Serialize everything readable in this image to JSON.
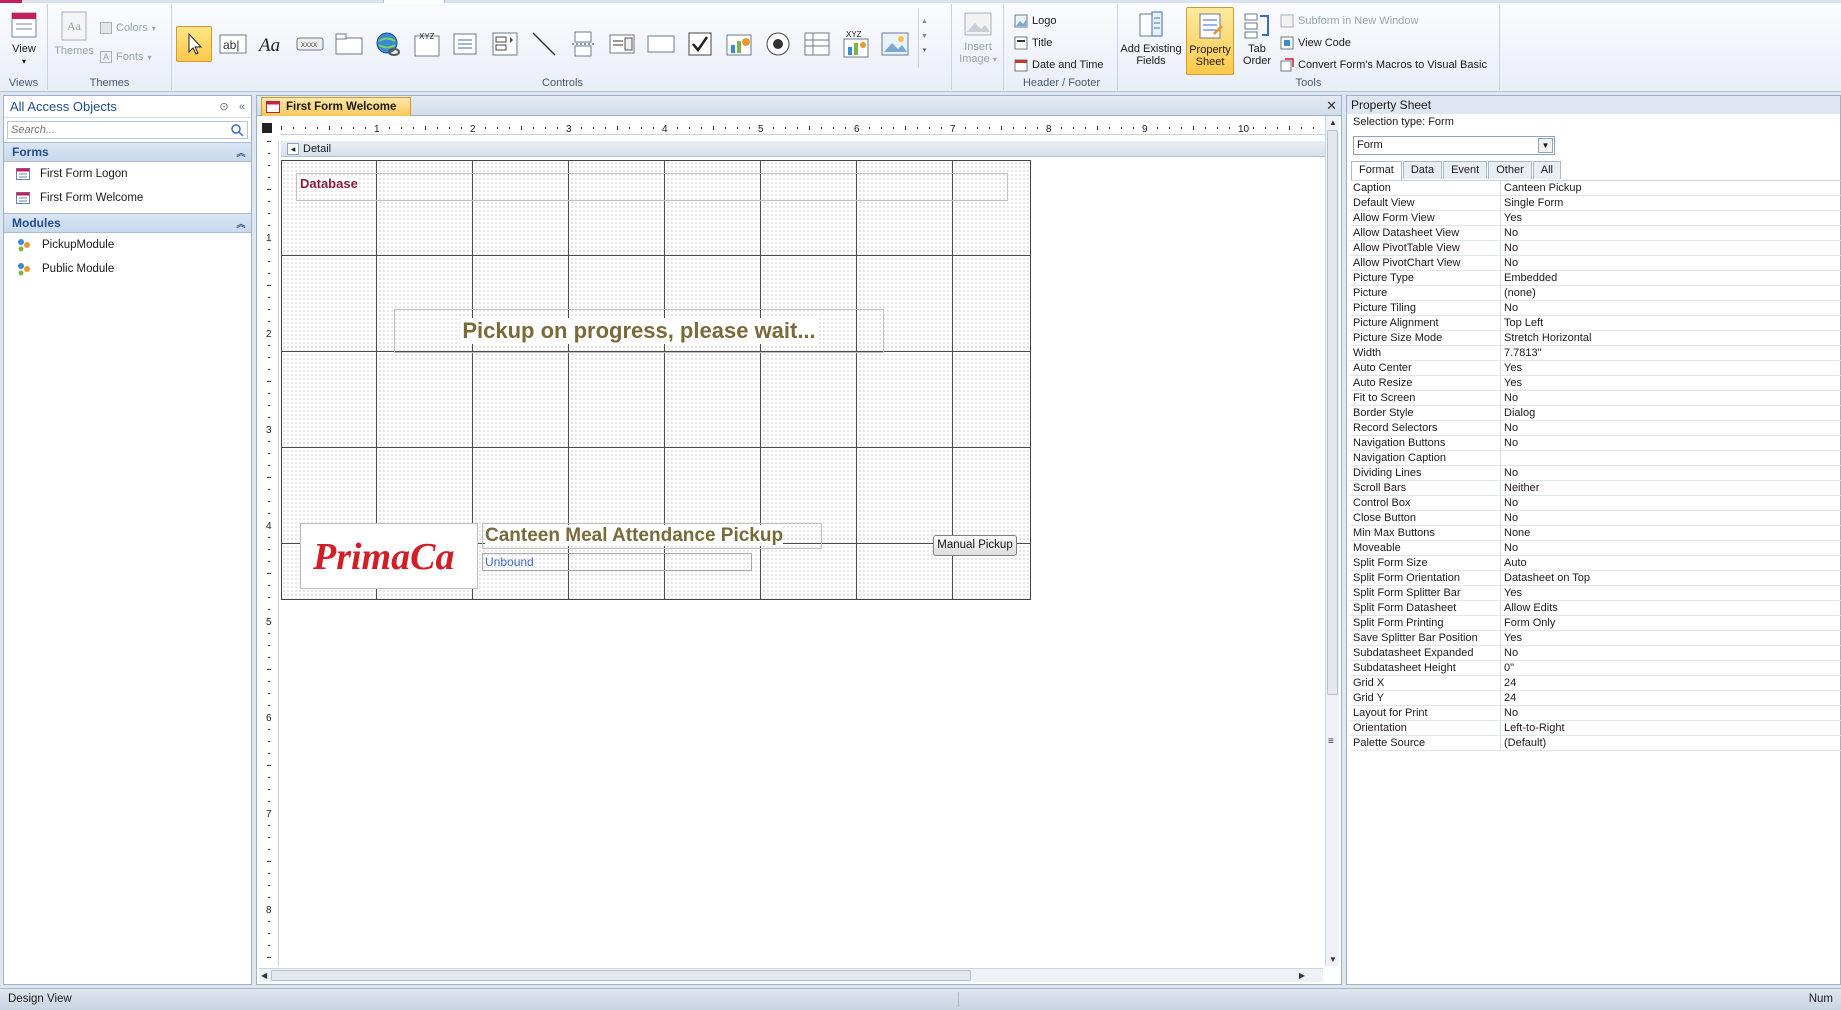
{
  "ribbon": {
    "views": {
      "view_label": "View",
      "group_label": "Views"
    },
    "themes": {
      "themes_label": "Themes",
      "colors_label": "Colors",
      "fonts_label": "Fonts",
      "group_label": "Themes"
    },
    "controls": {
      "group_label": "Controls",
      "insert_image_label": "Insert Image"
    },
    "header_footer": {
      "logo_label": "Logo",
      "title_label": "Title",
      "date_time_label": "Date and Time",
      "group_label": "Header / Footer"
    },
    "tools": {
      "add_existing_fields_label": "Add Existing Fields",
      "property_sheet_label": "Property Sheet",
      "tab_order_label": "Tab Order",
      "subform_label": "Subform in New Window",
      "view_code_label": "View Code",
      "convert_macros_label": "Convert Form's Macros to Visual Basic",
      "group_label": "Tools"
    }
  },
  "nav": {
    "title": "All Access Objects",
    "search_placeholder": "Search...",
    "sections": [
      {
        "title": "Forms",
        "items": [
          "First Form Logon",
          "First Form Welcome"
        ]
      },
      {
        "title": "Modules",
        "items": [
          "PickupModule",
          "Public Module"
        ]
      }
    ]
  },
  "document": {
    "tab_title": "First Form Welcome",
    "detail_label": "Detail",
    "ruler_numbers": [
      "1",
      "2",
      "3",
      "4",
      "5",
      "6",
      "7",
      "8",
      "9",
      "10"
    ],
    "vruler_numbers": [
      "1",
      "2",
      "3",
      "4",
      "5",
      "6",
      "7",
      "8"
    ],
    "form": {
      "database_label": "Database",
      "progress_label": "Pickup on progress, please wait...",
      "logo_text": "PrimaCa",
      "canteen_label": "Canteen Meal Attendance Pickup",
      "unbound_text": "Unbound",
      "manual_pickup_label": "Manual Pickup"
    }
  },
  "property_sheet": {
    "title": "Property Sheet",
    "selection_type": "Selection type:  Form",
    "selected_object": "Form",
    "tabs": [
      "Format",
      "Data",
      "Event",
      "Other",
      "All"
    ],
    "active_tab": "Format",
    "rows": [
      [
        "Caption",
        "Canteen Pickup"
      ],
      [
        "Default View",
        "Single Form"
      ],
      [
        "Allow Form View",
        "Yes"
      ],
      [
        "Allow Datasheet View",
        "No"
      ],
      [
        "Allow PivotTable View",
        "No"
      ],
      [
        "Allow PivotChart View",
        "No"
      ],
      [
        "Picture Type",
        "Embedded"
      ],
      [
        "Picture",
        "(none)"
      ],
      [
        "Picture Tiling",
        "No"
      ],
      [
        "Picture Alignment",
        "Top Left"
      ],
      [
        "Picture Size Mode",
        "Stretch Horizontal"
      ],
      [
        "Width",
        "7.7813\""
      ],
      [
        "Auto Center",
        "Yes"
      ],
      [
        "Auto Resize",
        "Yes"
      ],
      [
        "Fit to Screen",
        "No"
      ],
      [
        "Border Style",
        "Dialog"
      ],
      [
        "Record Selectors",
        "No"
      ],
      [
        "Navigation Buttons",
        "No"
      ],
      [
        "Navigation Caption",
        ""
      ],
      [
        "Dividing Lines",
        "No"
      ],
      [
        "Scroll Bars",
        "Neither"
      ],
      [
        "Control Box",
        "No"
      ],
      [
        "Close Button",
        "No"
      ],
      [
        "Min Max Buttons",
        "None"
      ],
      [
        "Moveable",
        "No"
      ],
      [
        "Split Form Size",
        "Auto"
      ],
      [
        "Split Form Orientation",
        "Datasheet on Top"
      ],
      [
        "Split Form Splitter Bar",
        "Yes"
      ],
      [
        "Split Form Datasheet",
        "Allow Edits"
      ],
      [
        "Split Form Printing",
        "Form Only"
      ],
      [
        "Save Splitter Bar Position",
        "Yes"
      ],
      [
        "Subdatasheet Expanded",
        "No"
      ],
      [
        "Subdatasheet Height",
        "0\""
      ],
      [
        "Grid X",
        "24"
      ],
      [
        "Grid Y",
        "24"
      ],
      [
        "Layout for Print",
        "No"
      ],
      [
        "Orientation",
        "Left-to-Right"
      ],
      [
        "Palette Source",
        "(Default)"
      ]
    ]
  },
  "status": {
    "left": "Design View",
    "right": "Num"
  },
  "colors": {
    "accent": "#f8c75d",
    "logo_red": "#d21e26",
    "label_olive": "#7a6a3a",
    "db_label": "#8b1c3a"
  }
}
